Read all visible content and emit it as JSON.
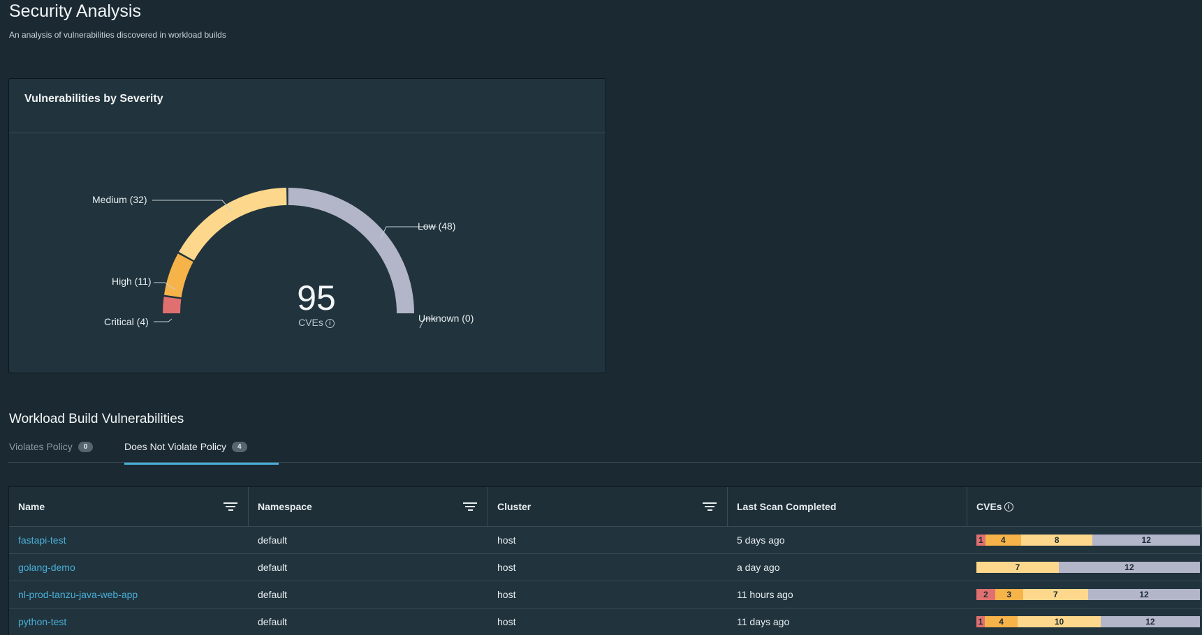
{
  "header": {
    "title": "Security Analysis",
    "subtitle": "An analysis of vulnerabilities discovered in workload builds"
  },
  "colors": {
    "critical": "#e07070",
    "high": "#f6b34a",
    "medium": "#fdd88c",
    "low": "#b3b5c9",
    "unknown": "#6b7a82",
    "accent": "#49afd9"
  },
  "severity_card": {
    "title": "Vulnerabilities by Severity",
    "total": "95",
    "total_unit": "CVEs",
    "labels": {
      "critical": "Critical (4)",
      "high": "High (11)",
      "medium": "Medium (32)",
      "low": "Low (48)",
      "unknown": "Unknown (0)"
    }
  },
  "chart_data": {
    "type": "pie",
    "title": "Vulnerabilities by Severity",
    "categories": [
      "Critical",
      "High",
      "Medium",
      "Low",
      "Unknown"
    ],
    "values": [
      4,
      11,
      32,
      48,
      0
    ]
  },
  "workloads": {
    "title": "Workload Build Vulnerabilities",
    "tabs": [
      {
        "label": "Violates Policy",
        "count": "0",
        "active": false
      },
      {
        "label": "Does Not Violate Policy",
        "count": "4",
        "active": true
      }
    ],
    "columns": [
      "Name",
      "Namespace",
      "Cluster",
      "Last Scan Completed",
      "CVEs"
    ],
    "rows": [
      {
        "name": "fastapi-test",
        "namespace": "default",
        "cluster": "host",
        "last_scan": "5 days ago",
        "cves": {
          "critical": 1,
          "high": 4,
          "medium": 8,
          "low": 12
        }
      },
      {
        "name": "golang-demo",
        "namespace": "default",
        "cluster": "host",
        "last_scan": "a day ago",
        "cves": {
          "critical": 0,
          "high": 0,
          "medium": 7,
          "low": 12
        }
      },
      {
        "name": "nl-prod-tanzu-java-web-app",
        "namespace": "default",
        "cluster": "host",
        "last_scan": "11 hours ago",
        "cves": {
          "critical": 2,
          "high": 3,
          "medium": 7,
          "low": 12
        }
      },
      {
        "name": "python-test",
        "namespace": "default",
        "cluster": "host",
        "last_scan": "11 days ago",
        "cves": {
          "critical": 1,
          "high": 4,
          "medium": 10,
          "low": 12
        }
      }
    ]
  }
}
